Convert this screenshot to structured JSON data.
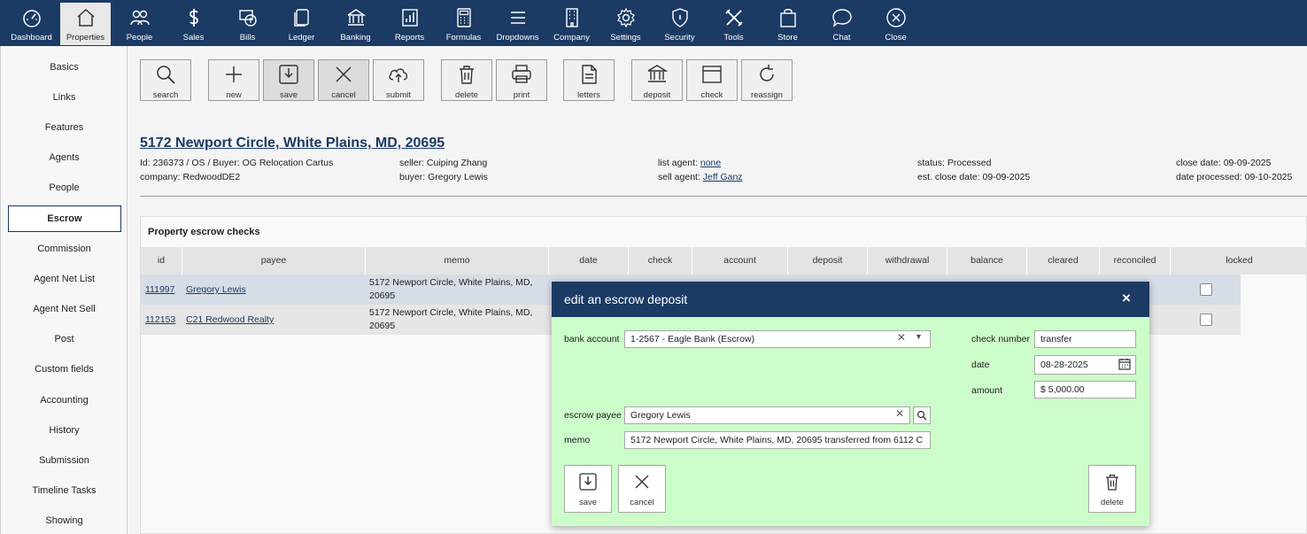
{
  "nav": [
    {
      "label": "Dashboard",
      "icon": "dashboard-icon"
    },
    {
      "label": "Properties",
      "icon": "house-icon",
      "active": true
    },
    {
      "label": "People",
      "icon": "people-icon"
    },
    {
      "label": "Sales",
      "icon": "dollar-icon"
    },
    {
      "label": "Bills",
      "icon": "bills-icon"
    },
    {
      "label": "Ledger",
      "icon": "ledger-icon"
    },
    {
      "label": "Banking",
      "icon": "bank-icon"
    },
    {
      "label": "Reports",
      "icon": "reports-icon"
    },
    {
      "label": "Formulas",
      "icon": "calculator-icon"
    },
    {
      "label": "Dropdowns",
      "icon": "menu-icon"
    },
    {
      "label": "Company",
      "icon": "building-icon"
    },
    {
      "label": "Settings",
      "icon": "gear-icon"
    },
    {
      "label": "Security",
      "icon": "shield-icon"
    },
    {
      "label": "Tools",
      "icon": "tools-icon"
    },
    {
      "label": "Store",
      "icon": "bag-icon"
    },
    {
      "label": "Chat",
      "icon": "chat-icon"
    },
    {
      "label": "Close",
      "icon": "close-icon"
    }
  ],
  "sidebar": [
    {
      "label": "Basics"
    },
    {
      "label": "Links"
    },
    {
      "label": "Features"
    },
    {
      "label": "Agents"
    },
    {
      "label": "People"
    },
    {
      "label": "Escrow",
      "active": true
    },
    {
      "label": "Commission"
    },
    {
      "label": "Agent Net List"
    },
    {
      "label": "Agent Net Sell"
    },
    {
      "label": "Post"
    },
    {
      "label": "Custom fields"
    },
    {
      "label": "Accounting"
    },
    {
      "label": "History"
    },
    {
      "label": "Submission"
    },
    {
      "label": "Timeline Tasks"
    },
    {
      "label": "Showing"
    }
  ],
  "toolbar": {
    "search": "search",
    "new": "new",
    "save": "save",
    "cancel": "cancel",
    "submit": "submit",
    "delete": "delete",
    "print": "print",
    "letters": "letters",
    "deposit": "deposit",
    "check": "check",
    "reassign": "reassign"
  },
  "property": {
    "title": "5172 Newport Circle, White Plains, MD, 20695",
    "id_line": "Id: 236373 / OS / Buyer: OG Relocation Cartus",
    "company": "company: RedwoodDE2",
    "seller": "seller: Cuiping Zhang",
    "buyer": "buyer: Gregory Lewis",
    "list_agent_label": "list agent:",
    "list_agent": "none",
    "sell_agent_label": "sell agent:",
    "sell_agent": "Jeff Ganz",
    "status": "status: Processed",
    "est_close": "est. close date: 09-09-2025",
    "close_date": "close date: 09-09-2025",
    "date_processed": "date processed: 09-10-2025"
  },
  "escrow_table": {
    "title": "Property escrow checks",
    "columns": [
      "id",
      "payee",
      "memo",
      "date",
      "check",
      "account",
      "deposit",
      "withdrawal",
      "balance",
      "cleared",
      "reconciled",
      "locked"
    ],
    "rows": [
      {
        "id": "111997",
        "payee": "Gregory Lewis",
        "memo": "5172 Newport Circle, White Plains, MD, 20695"
      },
      {
        "id": "112153",
        "payee": "C21 Redwood Realty",
        "memo": "5172 Newport Circle, White Plains, MD, 20695"
      }
    ]
  },
  "modal": {
    "title": "edit an escrow deposit",
    "close_glyph": "×",
    "bank_account_label": "bank account",
    "bank_account": "1-2567 - Eagle Bank (Escrow)",
    "check_number_label": "check number",
    "check_number": "transfer",
    "date_label": "date",
    "date": "08-28-2025",
    "amount_label": "amount",
    "amount": "$ 5,000.00",
    "payee_label": "escrow payee",
    "payee": "Gregory Lewis",
    "memo_label": "memo",
    "memo": "5172 Newport Circle, White Plains, MD, 20695 transferred from 6112 C",
    "save": "save",
    "cancel": "cancel",
    "delete": "delete"
  }
}
